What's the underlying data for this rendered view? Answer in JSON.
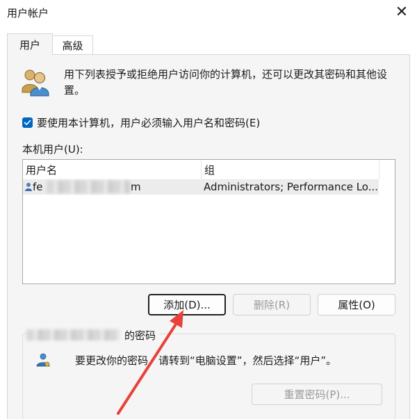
{
  "window": {
    "title": "用户帐户",
    "close_glyph": "✕"
  },
  "tabs": [
    {
      "label": "用户"
    },
    {
      "label": "高级"
    }
  ],
  "intro_text": "用下列表授予或拒绝用户访问你的计算机，还可以更改其密码和其他设置。",
  "require_login": {
    "label": "要使用本计算机，用户必须输入用户名和密码(E)",
    "checked": true
  },
  "local_users": {
    "label": "本机用户(U):",
    "columns": [
      "用户名",
      "组"
    ],
    "rows": [
      {
        "username_visible": "fe",
        "username_suffix": "m",
        "group": "Administrators; Performance Lo..."
      }
    ]
  },
  "buttons": {
    "add": "添加(D)...",
    "remove": "删除(R)",
    "properties": "属性(O)",
    "reset_password": "重置密码(P)..."
  },
  "password_group": {
    "legend_suffix": "的密码",
    "message": "要更改你的密码，请转到“电脑设置”，然后选择“用户”。"
  },
  "colors": {
    "accent": "#0067c0",
    "annotation_arrow": "#e8413b"
  },
  "icons": {
    "users": "users-icon",
    "key_user": "user-key-icon",
    "close": "close-icon",
    "check": "checkmark-icon"
  }
}
